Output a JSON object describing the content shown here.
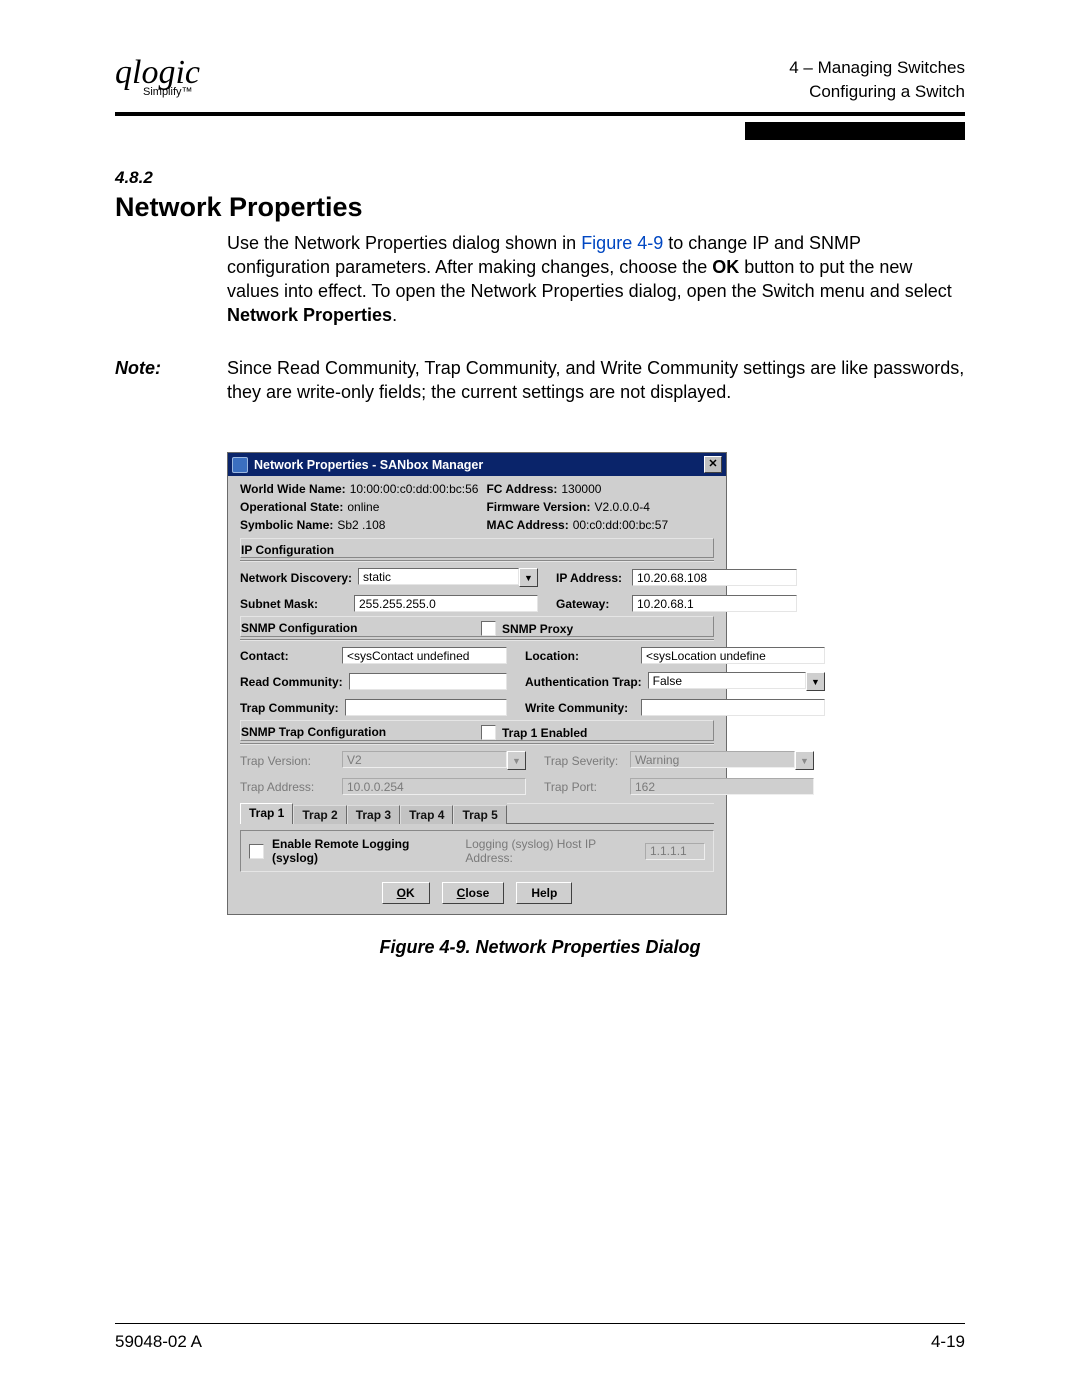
{
  "header": {
    "logo": "qlogic",
    "logo_tag": "Simplify™",
    "line1": "4 – Managing Switches",
    "line2": "Configuring a Switch"
  },
  "section": {
    "number": "4.8.2",
    "title": "Network Properties"
  },
  "body": {
    "p1a": "Use the Network Properties dialog shown in ",
    "figure_link": "Figure 4-9",
    "p1b": " to change IP and SNMP configuration parameters. After making changes, choose the ",
    "ok_word": "OK",
    "p1c": " button to put the new values into effect. To open the Network Properties dialog, open the Switch menu and select ",
    "np_word": "Network Properties",
    "p1d": "."
  },
  "note": {
    "label": "Note:",
    "text": "Since Read Community, Trap Community, and Write Community settings are like passwords, they are write-only fields; the current settings are not displayed."
  },
  "dialog": {
    "title": "Network Properties - SANbox Manager",
    "info": {
      "wwn_label": "World Wide Name:",
      "wwn_value": "10:00:00:c0:dd:00:bc:56",
      "fc_label": "FC Address:",
      "fc_value": "130000",
      "op_label": "Operational State:",
      "op_value": "online",
      "fw_label": "Firmware Version:",
      "fw_value": "V2.0.0.0-4",
      "sym_label": "Symbolic Name:",
      "sym_value": "Sb2 .108",
      "mac_label": "MAC Address:",
      "mac_value": "00:c0:dd:00:bc:57"
    },
    "ip_config": {
      "header": "IP Configuration",
      "net_disc_label": "Network Discovery:",
      "net_disc_value": "static",
      "ip_addr_label": "IP Address:",
      "ip_addr_value": "10.20.68.108",
      "subnet_label": "Subnet Mask:",
      "subnet_value": "255.255.255.0",
      "gateway_label": "Gateway:",
      "gateway_value": "10.20.68.1"
    },
    "snmp": {
      "header": "SNMP Configuration",
      "proxy_label": "SNMP Proxy",
      "contact_label": "Contact:",
      "contact_value": "<sysContact undefined",
      "location_label": "Location:",
      "location_value": "<sysLocation undefine",
      "read_label": "Read Community:",
      "read_value": "",
      "auth_label": "Authentication Trap:",
      "auth_value": "False",
      "trap_label": "Trap Community:",
      "trap_value": "",
      "write_label": "Write Community:",
      "write_value": ""
    },
    "trap": {
      "header": "SNMP Trap Configuration",
      "enabled_label": "Trap 1 Enabled",
      "version_label": "Trap Version:",
      "version_value": "V2",
      "severity_label": "Trap Severity:",
      "severity_value": "Warning",
      "address_label": "Trap Address:",
      "address_value": "10.0.0.254",
      "port_label": "Trap Port:",
      "port_value": "162",
      "tabs": [
        "Trap 1",
        "Trap 2",
        "Trap 3",
        "Trap 4",
        "Trap 5"
      ]
    },
    "logging": {
      "enable_label": "Enable Remote Logging (syslog)",
      "host_label": "Logging (syslog) Host IP Address:",
      "host_value": "1.1.1.1"
    },
    "buttons": {
      "ok": "OK",
      "close": "Close",
      "help": "Help"
    }
  },
  "figure_caption": "Figure 4-9.  Network Properties Dialog",
  "footer": {
    "left": "59048-02  A",
    "right": "4-19"
  }
}
